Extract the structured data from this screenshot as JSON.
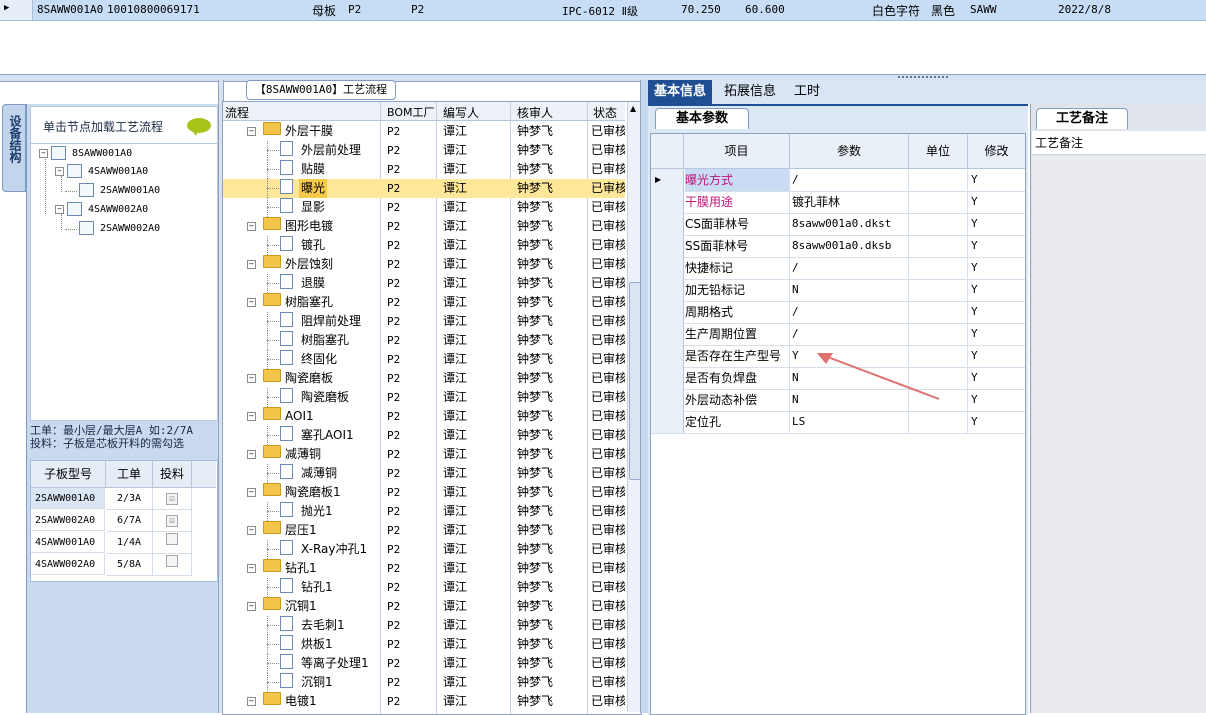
{
  "top_row": {
    "code": "8SAWW001A0",
    "id": "10010800069171",
    "type": "母板",
    "layer_a": "P2",
    "layer_b": "P2",
    "grade": "IPC-6012 Ⅱ级",
    "width": "70.250",
    "height": "60.600",
    "char_color": "白色字符",
    "mask_color": "黑色",
    "customer": "SAWW",
    "date": "2022/8/8"
  },
  "left": {
    "side_tab": "设备结构",
    "hint": "单击节点加载工艺流程",
    "tree": [
      {
        "label": "8SAWW001A0"
      },
      {
        "label": "4SAWW001A0"
      },
      {
        "label": "2SAWW001A0"
      },
      {
        "label": "4SAWW002A0"
      },
      {
        "label": "2SAWW002A0"
      }
    ],
    "note_line1": "工单：最小层/最大层A 如:2/7A",
    "note_line2": "投料：子板是芯板开料的需勾选",
    "sub_table": {
      "headers": [
        "子板型号",
        "工单",
        "投料"
      ],
      "rows": [
        {
          "model": "2SAWW001A0",
          "order": "2/3A",
          "feed": "☑"
        },
        {
          "model": "2SAWW002A0",
          "order": "6/7A",
          "feed": "☑"
        },
        {
          "model": "4SAWW001A0",
          "order": "1/4A",
          "feed": ""
        },
        {
          "model": "4SAWW002A0",
          "order": "5/8A",
          "feed": ""
        }
      ]
    }
  },
  "middle": {
    "caption": "【8SAWW001A0】工艺流程",
    "headers": {
      "flow": "流程",
      "bom": "BOM工厂",
      "writer": "编写人",
      "reviewer": "核审人",
      "status": "状态"
    },
    "rows": [
      {
        "name": "外层干膜",
        "folder": true,
        "bom": "P2",
        "writer": "谭江",
        "reviewer": "钟梦飞",
        "status": "已审核"
      },
      {
        "name": "外层前处理",
        "folder": false,
        "bom": "P2",
        "writer": "谭江",
        "reviewer": "钟梦飞",
        "status": "已审核"
      },
      {
        "name": "贴膜",
        "folder": false,
        "bom": "P2",
        "writer": "谭江",
        "reviewer": "钟梦飞",
        "status": "已审核"
      },
      {
        "name": "曝光",
        "folder": false,
        "bom": "P2",
        "writer": "谭江",
        "reviewer": "钟梦飞",
        "status": "已审核",
        "selected": true
      },
      {
        "name": "显影",
        "folder": false,
        "bom": "P2",
        "writer": "谭江",
        "reviewer": "钟梦飞",
        "status": "已审核"
      },
      {
        "name": "图形电镀",
        "folder": true,
        "bom": "P2",
        "writer": "谭江",
        "reviewer": "钟梦飞",
        "status": "已审核"
      },
      {
        "name": "镀孔",
        "folder": false,
        "bom": "P2",
        "writer": "谭江",
        "reviewer": "钟梦飞",
        "status": "已审核"
      },
      {
        "name": "外层蚀刻",
        "folder": true,
        "bom": "P2",
        "writer": "谭江",
        "reviewer": "钟梦飞",
        "status": "已审核"
      },
      {
        "name": "退膜",
        "folder": false,
        "bom": "P2",
        "writer": "谭江",
        "reviewer": "钟梦飞",
        "status": "已审核"
      },
      {
        "name": "树脂塞孔",
        "folder": true,
        "bom": "P2",
        "writer": "谭江",
        "reviewer": "钟梦飞",
        "status": "已审核"
      },
      {
        "name": "阻焊前处理",
        "folder": false,
        "bom": "P2",
        "writer": "谭江",
        "reviewer": "钟梦飞",
        "status": "已审核"
      },
      {
        "name": "树脂塞孔",
        "folder": false,
        "bom": "P2",
        "writer": "谭江",
        "reviewer": "钟梦飞",
        "status": "已审核"
      },
      {
        "name": "终固化",
        "folder": false,
        "bom": "P2",
        "writer": "谭江",
        "reviewer": "钟梦飞",
        "status": "已审核"
      },
      {
        "name": "陶瓷磨板",
        "folder": true,
        "bom": "P2",
        "writer": "谭江",
        "reviewer": "钟梦飞",
        "status": "已审核"
      },
      {
        "name": "陶瓷磨板",
        "folder": false,
        "bom": "P2",
        "writer": "谭江",
        "reviewer": "钟梦飞",
        "status": "已审核"
      },
      {
        "name": "AOI1",
        "folder": true,
        "bom": "P2",
        "writer": "谭江",
        "reviewer": "钟梦飞",
        "status": "已审核"
      },
      {
        "name": "塞孔AOI1",
        "folder": false,
        "bom": "P2",
        "writer": "谭江",
        "reviewer": "钟梦飞",
        "status": "已审核"
      },
      {
        "name": "减薄铜",
        "folder": true,
        "bom": "P2",
        "writer": "谭江",
        "reviewer": "钟梦飞",
        "status": "已审核"
      },
      {
        "name": "减薄铜",
        "folder": false,
        "bom": "P2",
        "writer": "谭江",
        "reviewer": "钟梦飞",
        "status": "已审核"
      },
      {
        "name": "陶瓷磨板1",
        "folder": true,
        "bom": "P2",
        "writer": "谭江",
        "reviewer": "钟梦飞",
        "status": "已审核"
      },
      {
        "name": "抛光1",
        "folder": false,
        "bom": "P2",
        "writer": "谭江",
        "reviewer": "钟梦飞",
        "status": "已审核"
      },
      {
        "name": "层压1",
        "folder": true,
        "bom": "P2",
        "writer": "谭江",
        "reviewer": "钟梦飞",
        "status": "已审核"
      },
      {
        "name": "X-Ray冲孔1",
        "folder": false,
        "bom": "P2",
        "writer": "谭江",
        "reviewer": "钟梦飞",
        "status": "已审核"
      },
      {
        "name": "钻孔1",
        "folder": true,
        "bom": "P2",
        "writer": "谭江",
        "reviewer": "钟梦飞",
        "status": "已审核"
      },
      {
        "name": "钻孔1",
        "folder": false,
        "bom": "P2",
        "writer": "谭江",
        "reviewer": "钟梦飞",
        "status": "已审核"
      },
      {
        "name": "沉铜1",
        "folder": true,
        "bom": "P2",
        "writer": "谭江",
        "reviewer": "钟梦飞",
        "status": "已审核"
      },
      {
        "name": "去毛刺1",
        "folder": false,
        "bom": "P2",
        "writer": "谭江",
        "reviewer": "钟梦飞",
        "status": "已审核"
      },
      {
        "name": "烘板1",
        "folder": false,
        "bom": "P2",
        "writer": "谭江",
        "reviewer": "钟梦飞",
        "status": "已审核"
      },
      {
        "name": "等离子处理1",
        "folder": false,
        "bom": "P2",
        "writer": "谭江",
        "reviewer": "钟梦飞",
        "status": "已审核"
      },
      {
        "name": "沉铜1",
        "folder": false,
        "bom": "P2",
        "writer": "谭江",
        "reviewer": "钟梦飞",
        "status": "已审核"
      },
      {
        "name": "电镀1",
        "folder": true,
        "bom": "P2",
        "writer": "谭江",
        "reviewer": "钟梦飞",
        "status": "已审核"
      }
    ]
  },
  "right": {
    "tabs": [
      "基本信息",
      "拓展信息",
      "工时"
    ],
    "sub_tab": "基本参数",
    "headers": {
      "item": "项目",
      "param": "参数",
      "unit": "单位",
      "modify": "修改"
    },
    "rows": [
      {
        "item": "曝光方式",
        "param": "/",
        "unit": "",
        "modify": "Y",
        "color": "#c0147a",
        "current": true
      },
      {
        "item": "干膜用途",
        "param": "镀孔菲林",
        "unit": "",
        "modify": "Y",
        "color": "#c0147a"
      },
      {
        "item": "CS面菲林号",
        "param": "8saww001a0.dkst",
        "unit": "",
        "modify": "Y"
      },
      {
        "item": "SS面菲林号",
        "param": "8saww001a0.dksb",
        "unit": "",
        "modify": "Y"
      },
      {
        "item": "快捷标记",
        "param": "/",
        "unit": "",
        "modify": "Y"
      },
      {
        "item": "加无铅标记",
        "param": "N",
        "unit": "",
        "modify": "Y"
      },
      {
        "item": "周期格式",
        "param": "/",
        "unit": "",
        "modify": "Y"
      },
      {
        "item": "生产周期位置",
        "param": "/",
        "unit": "",
        "modify": "Y"
      },
      {
        "item": "是否存在生产型号",
        "param": "Y",
        "unit": "",
        "modify": "Y"
      },
      {
        "item": "是否有负焊盘",
        "param": "N",
        "unit": "",
        "modify": "Y"
      },
      {
        "item": "外层动态补偿",
        "param": "N",
        "unit": "",
        "modify": "Y"
      },
      {
        "item": "定位孔",
        "param": "LS",
        "unit": "",
        "modify": "Y"
      }
    ],
    "note_tab": "工艺备注",
    "note_header": "工艺备注"
  },
  "colors": {
    "accent": "#1f4e92",
    "selection": "#ffe79a",
    "highlight_text": "#c0147a",
    "arrow": "#e07070"
  }
}
